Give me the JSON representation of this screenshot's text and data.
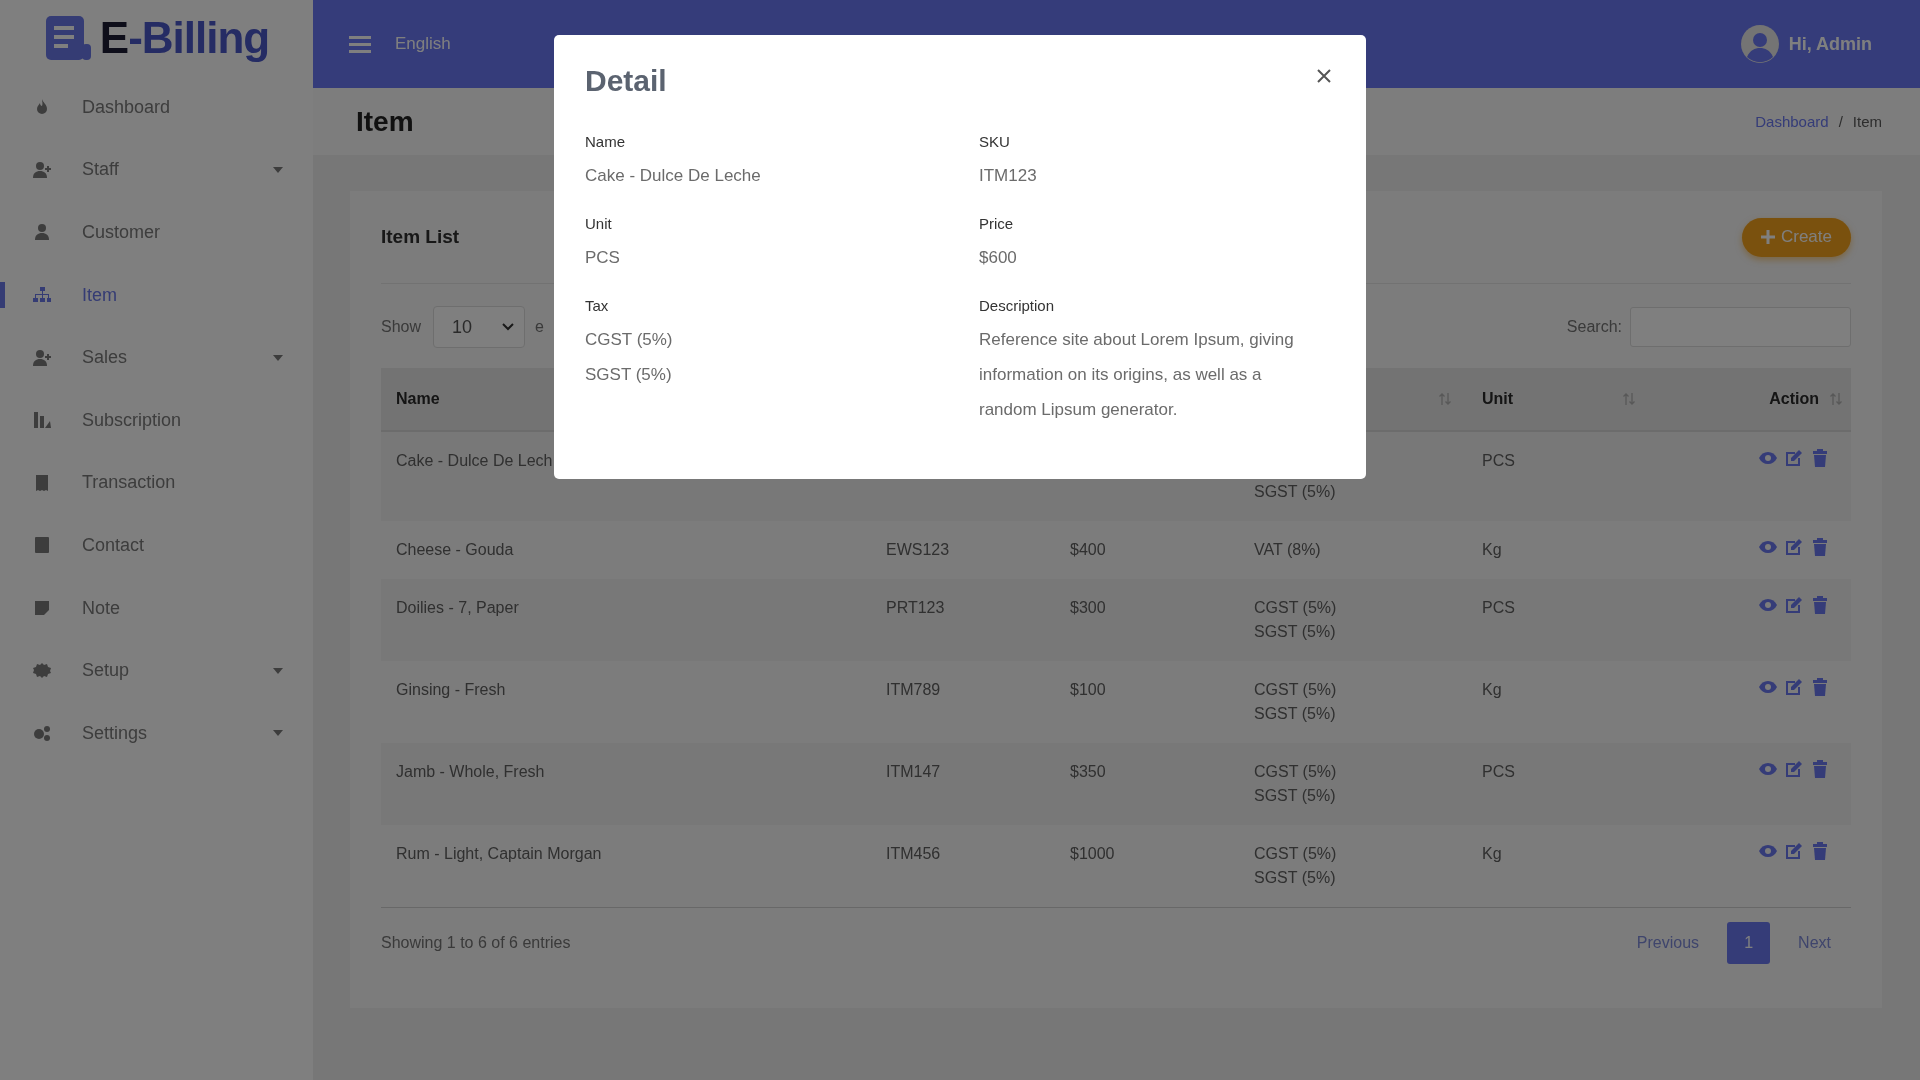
{
  "sidebar": {
    "logo": "E-Billing",
    "items": [
      {
        "label": "Dashboard",
        "kind": "fire",
        "selected": false,
        "expandable": false
      },
      {
        "label": "Staff",
        "kind": "user-plus",
        "selected": false,
        "expandable": true
      },
      {
        "label": "Customer",
        "kind": "user",
        "selected": false,
        "expandable": false
      },
      {
        "label": "Item",
        "kind": "sitemap",
        "selected": true,
        "expandable": false
      },
      {
        "label": "Sales",
        "kind": "user-plus",
        "selected": false,
        "expandable": true
      },
      {
        "label": "Subscription",
        "kind": "chart",
        "selected": false,
        "expandable": false
      },
      {
        "label": "Transaction",
        "kind": "receipt",
        "selected": false,
        "expandable": false
      },
      {
        "label": "Contact",
        "kind": "contact",
        "selected": false,
        "expandable": false
      },
      {
        "label": "Note",
        "kind": "note",
        "selected": false,
        "expandable": false
      },
      {
        "label": "Setup",
        "kind": "gear",
        "selected": false,
        "expandable": true
      },
      {
        "label": "Settings",
        "kind": "gears",
        "selected": false,
        "expandable": true
      }
    ]
  },
  "header": {
    "language": "English",
    "user": "Hi, Admin"
  },
  "page": {
    "title": "Item",
    "breadcrumb": [
      {
        "label": "Dashboard",
        "link": true
      },
      {
        "label": "Item",
        "link": false
      }
    ],
    "breadcrumb_separator": "/"
  },
  "card": {
    "title": "Item List",
    "create_button": "Create",
    "show_label": "Show",
    "page_size": "10",
    "entries_label": "e",
    "search_label": "Search:",
    "table": {
      "columns": [
        {
          "label": "Name"
        },
        {},
        {},
        {
          "sort_icon": true
        },
        {
          "label": "Unit",
          "sort_icon": true
        },
        {
          "label": "Action",
          "sort_icon": true
        }
      ],
      "rows": [
        {
          "name": "Cake - Dulce De Lech",
          "taxes": [
            "SGST (5%)"
          ],
          "unit": "PCS"
        },
        {
          "name": "Cheese - Gouda",
          "sku": "EWS123",
          "price": "$400",
          "taxes": [
            "VAT (8%)"
          ],
          "unit": "Kg"
        },
        {
          "name": "Doilies - 7, Paper",
          "sku": "PRT123",
          "price": "$300",
          "taxes": [
            "CGST (5%)",
            "SGST (5%)"
          ],
          "unit": "PCS"
        },
        {
          "name": "Ginsing - Fresh",
          "sku": "ITM789",
          "price": "$100",
          "taxes": [
            "CGST (5%)",
            "SGST (5%)"
          ],
          "unit": "Kg"
        },
        {
          "name": "Jamb - Whole, Fresh",
          "sku": "ITM147",
          "price": "$350",
          "taxes": [
            "CGST (5%)",
            "SGST (5%)"
          ],
          "unit": "PCS"
        },
        {
          "name": "Rum - Light, Captain Morgan",
          "sku": "ITM456",
          "price": "$1000",
          "taxes": [
            "CGST (5%)",
            "SGST (5%)"
          ],
          "unit": "Kg"
        }
      ]
    },
    "info": "Showing 1 to 6 of 6 entries",
    "pagination": [
      {
        "label": "Previous",
        "kind": "prev",
        "selected": false
      },
      {
        "label": "1",
        "kind": "page",
        "selected": true
      },
      {
        "label": "Next",
        "kind": "next",
        "selected": false
      }
    ]
  },
  "modal": {
    "title": "Detail",
    "fields": [
      {
        "label": "Name",
        "values": [
          "Cake - Dulce De Leche"
        ]
      },
      {
        "label": "SKU",
        "values": [
          "ITM123"
        ]
      },
      {
        "label": "Unit",
        "values": [
          "PCS"
        ]
      },
      {
        "label": "Price",
        "values": [
          "$600"
        ]
      },
      {
        "label": "Tax",
        "values": [
          "CGST (5%)",
          "SGST (5%)"
        ]
      },
      {
        "label": "Description",
        "values": [
          "Reference site about Lorem Ipsum, giving information on its origins, as well as a random Lipsum generator."
        ]
      }
    ]
  }
}
